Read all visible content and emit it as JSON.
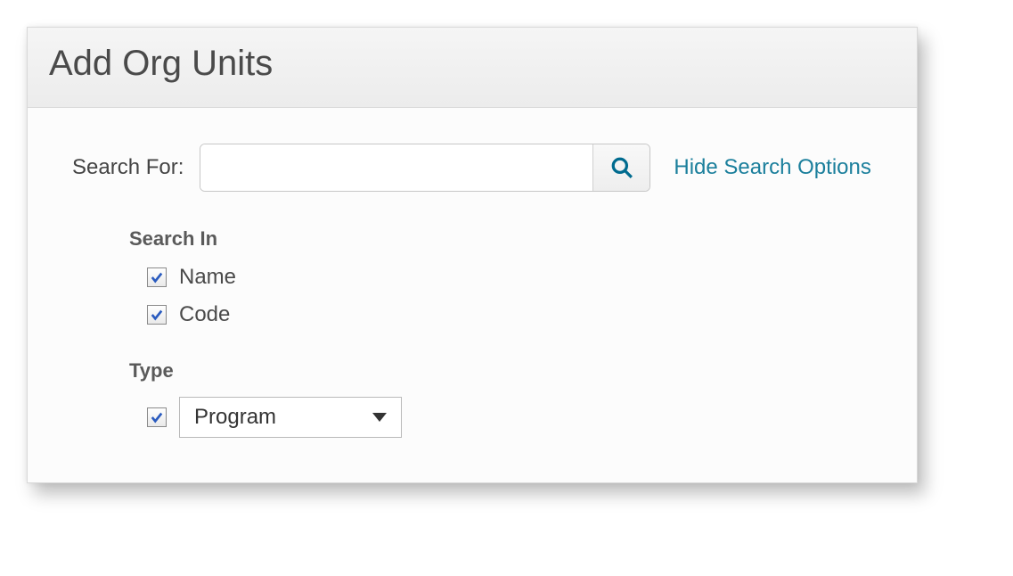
{
  "header": {
    "title": "Add Org Units"
  },
  "search": {
    "label": "Search For:",
    "value": "",
    "placeholder": "",
    "toggle_label": "Hide Search Options"
  },
  "search_in": {
    "title": "Search In",
    "options": [
      {
        "label": "Name",
        "checked": true
      },
      {
        "label": "Code",
        "checked": true
      }
    ]
  },
  "type": {
    "title": "Type",
    "enabled": true,
    "selected": "Program"
  }
}
